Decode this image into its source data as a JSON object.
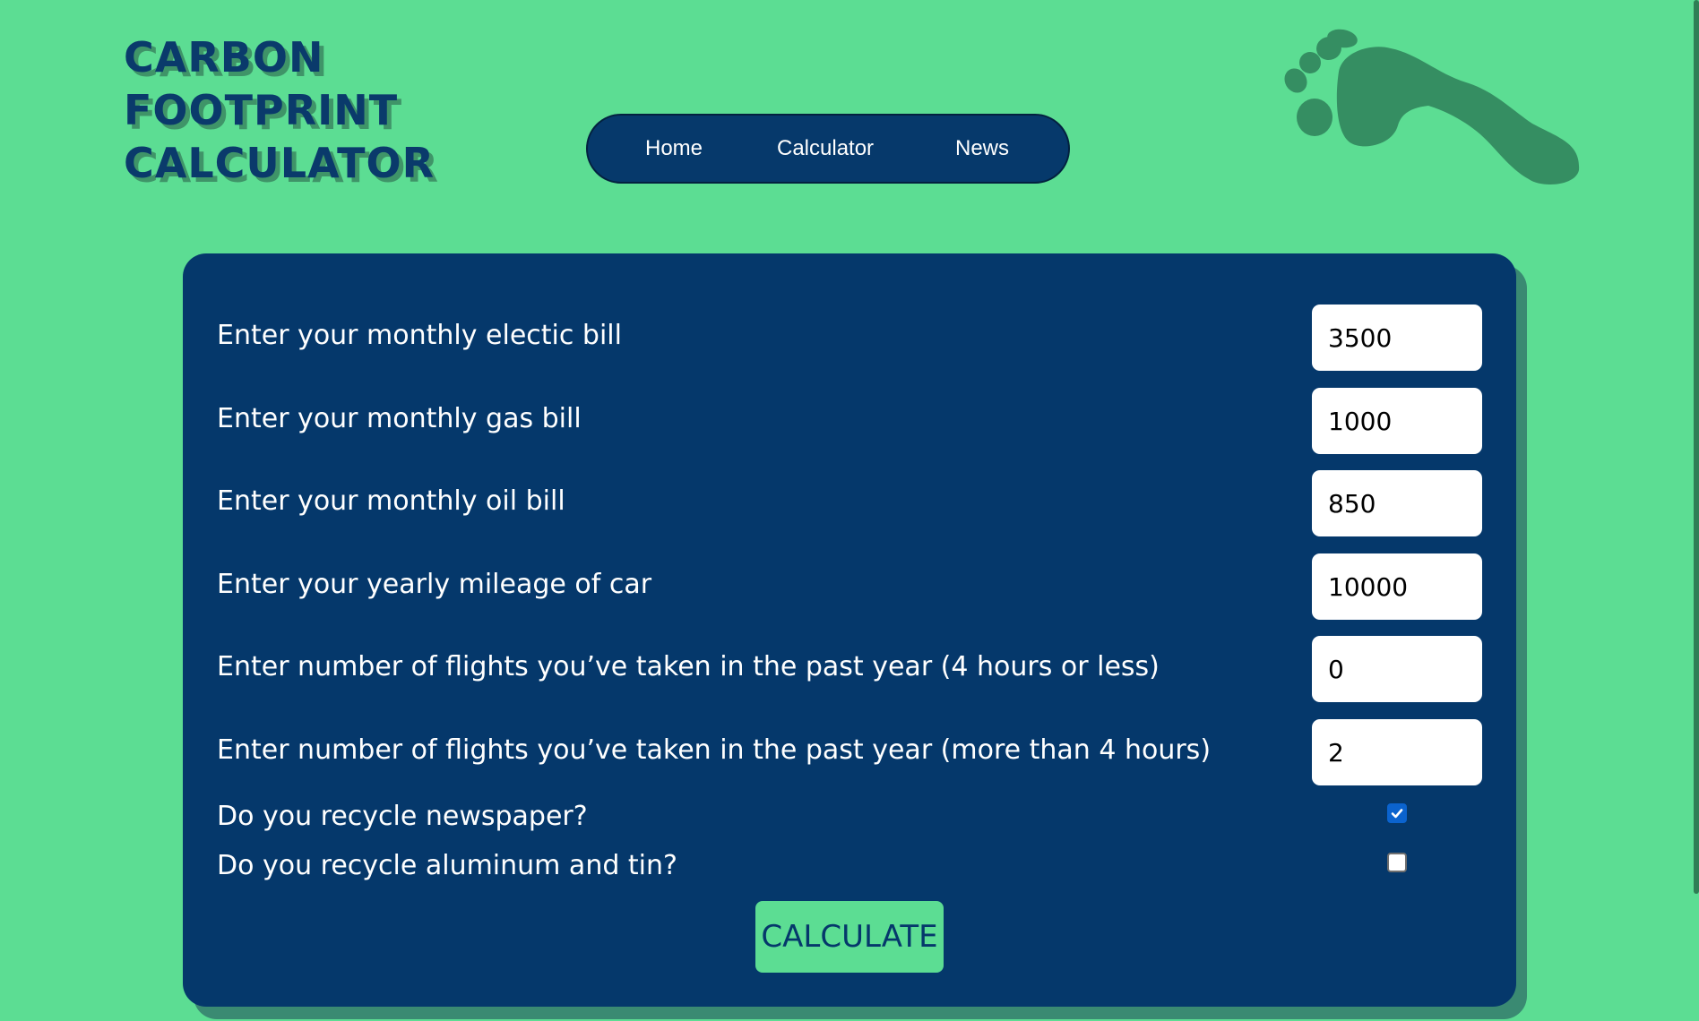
{
  "site": {
    "logo_lines": [
      "CARBON",
      "FOOTPRINT",
      "CALCULATOR"
    ]
  },
  "nav": {
    "items": [
      {
        "label": "Home"
      },
      {
        "label": "Calculator"
      },
      {
        "label": "News"
      }
    ]
  },
  "decor": {
    "icon": "footprint-icon",
    "icon_color": "#358e62"
  },
  "colors": {
    "page_background": "#5cdd93",
    "card_background": "#05386b",
    "card_shadow": "#3a8a72",
    "accent": "#5cdd93",
    "checkbox_checked": "#0b63ce"
  },
  "form": {
    "fields": [
      {
        "label": "Enter your monthly electic bill",
        "value": "3500"
      },
      {
        "label": "Enter your monthly gas bill",
        "value": "1000"
      },
      {
        "label": "Enter your monthly oil bill",
        "value": "850"
      },
      {
        "label": "Enter your yearly mileage of car",
        "value": "10000"
      },
      {
        "label": "Enter number of flights you’ve taken in the past year (4 hours or less)",
        "value": "0"
      },
      {
        "label": "Enter number of flights you’ve taken in the past year (more than 4 hours)",
        "value": "2"
      }
    ],
    "checkboxes": [
      {
        "label": "Do you recycle newspaper?",
        "checked": true
      },
      {
        "label": "Do you recycle aluminum and tin?",
        "checked": false
      }
    ],
    "submit_label": "CALCULATE"
  }
}
